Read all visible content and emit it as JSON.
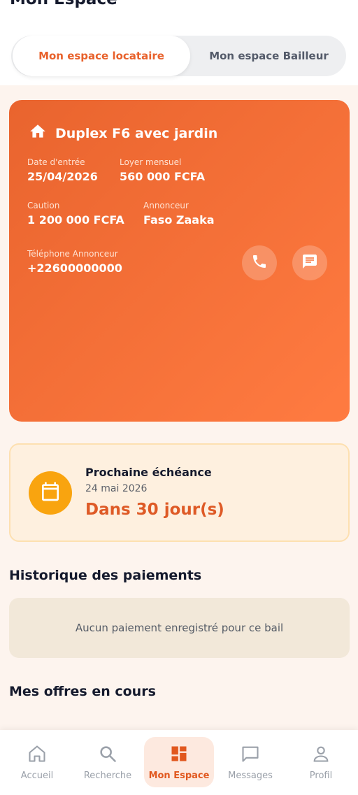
{
  "header": {
    "title": "Mon Espace"
  },
  "tabs": [
    {
      "label": "Mon espace locataire",
      "active": true
    },
    {
      "label": "Mon espace Bailleur",
      "active": false
    }
  ],
  "property": {
    "icon": "home-icon",
    "title": "Duplex F6 avec jardin",
    "entry_date": {
      "label": "Date d'entrée",
      "value": "25/04/2026"
    },
    "monthly_rent": {
      "label": "Loyer mensuel",
      "value": "560 000 FCFA"
    },
    "deposit": {
      "label": "Caution",
      "value": "1 200 000 FCFA"
    },
    "advertiser": {
      "label": "Annonceur",
      "value": "Faso Zaaka"
    },
    "phone": {
      "label": "Téléphone Annonceur",
      "value": "+22600000000"
    },
    "call_icon": "phone-icon",
    "message_icon": "chat-icon"
  },
  "next_due": {
    "icon": "calendar-icon",
    "title": "Prochaine échéance",
    "date": "24 mai 2026",
    "countdown": "Dans 30 jour(s)"
  },
  "payments": {
    "title": "Historique des paiements",
    "empty_text": "Aucun paiement enregistré pour ce bail"
  },
  "offers": {
    "title": "Mes offres en cours"
  },
  "bottom_nav": [
    {
      "label": "Accueil",
      "icon": "home-outline-icon",
      "active": false
    },
    {
      "label": "Recherche",
      "icon": "search-icon",
      "active": false
    },
    {
      "label": "Mon Espace",
      "icon": "dashboard-icon",
      "active": true
    },
    {
      "label": "Messages",
      "icon": "message-square-icon",
      "active": false
    },
    {
      "label": "Profil",
      "icon": "user-icon",
      "active": false
    }
  ],
  "colors": {
    "accent": "#e8612b",
    "card_gradient_start": "#e9642e",
    "card_gradient_end": "#ff7b41",
    "due_bg": "#fef0df",
    "calendar_yellow": "#f9a40f"
  }
}
